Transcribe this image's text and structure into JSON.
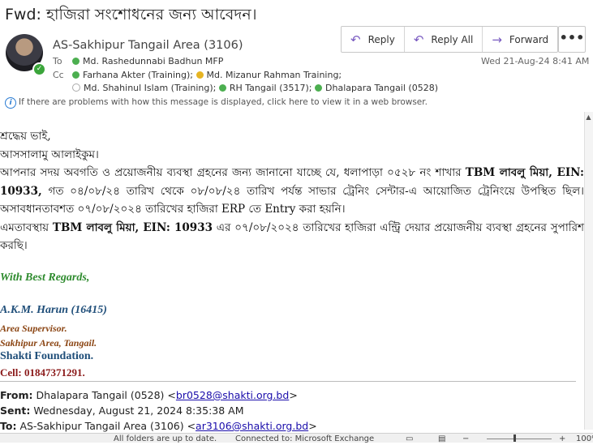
{
  "subject": "Fwd: হাজিরা সংশোধনের জন্য আবেদন।",
  "sender": "AS-Sakhipur Tangail Area (3106)",
  "to_label": "To",
  "cc_label": "Cc",
  "to": [
    "Md. Rashedunnabi Badhun MFP"
  ],
  "cc_line1": [
    "Farhana Akter (Training);",
    "Md. Mizanur Rahman Training;"
  ],
  "cc_line2": [
    "Md. Shahinul Islam (Training);",
    "RH Tangail (3517);",
    "Dhalapara Tangail (0528)"
  ],
  "actions": {
    "reply": "Reply",
    "reply_all": "Reply All",
    "forward": "Forward",
    "more": "•••"
  },
  "date": "Wed 21-Aug-24 8:41 AM",
  "info_bar": "If there are problems with how this message is displayed, click here to view it in a web browser.",
  "body": {
    "greeting": "শ্রদ্ধেয় ভাই,",
    "salam": "আসসালামু আলাইকুম।",
    "p1_a": "আপনার সদয় অবগতি ও প্রয়োজনীয় ব্যবস্থা গ্রহনের জন্য জানানো যাচ্ছে যে, ধলাপাড়া ০৫২৮ নং শাখার ",
    "p1_bold": "TBM লাবলু মিয়া, EIN: 10933,",
    "p1_b": " গত ০৪/০৮/২৪ তারিখ থেকে ০৮/০৮/২৪ তারিখ পর্যন্ত সাভার ট্রেনিং সেন্টার-এ আয়োজিত ট্রেনিংয়ে উপস্থিত ছিল। অসাবধানতাবশত ০৭/০৮/২০২৪ তারিখের হাজিরা ERP তে Entry করা হয়নি।",
    "p2_a": "এমতাবস্থায় ",
    "p2_bold": "TBM লাবলু মিয়া, EIN: 10933",
    "p2_b": " এর ০৭/০৮/২০২৪ তারিখের হাজিরা এন্ট্রি দেয়ার প্রয়োজনীয় ব্যবস্থা গ্রহনের সুপারিশ করছি।"
  },
  "signature": {
    "regards": "With Best Regards,",
    "name": "A.K.M. Harun (16415)",
    "role1": "Area Supervisor.",
    "role2": "Sakhipur Area, Tangail.",
    "org": "Shakti Foundation.",
    "cell": "Cell: 01847371291."
  },
  "forwarded": {
    "from_label": "From:",
    "from_name": "Dhalapara Tangail (0528) <",
    "from_email": "br0528@shakti.org.bd",
    "from_close": ">",
    "sent_label": "Sent:",
    "sent_value": "Wednesday, August 21, 2024 8:35:38 AM",
    "to_label": "To:",
    "to_name": "AS-Sakhipur Tangail Area (3106) <",
    "to_email": "ar3106@shakti.org.bd",
    "to_close": ">"
  },
  "status_bar": {
    "left": "All folders are up to date.",
    "right": "Connected to: Microsoft Exchange",
    "zoom": "100%"
  },
  "colors": {
    "accent": "#7a5bc1",
    "presence": "#4caf50",
    "link": "#1a0dab"
  }
}
